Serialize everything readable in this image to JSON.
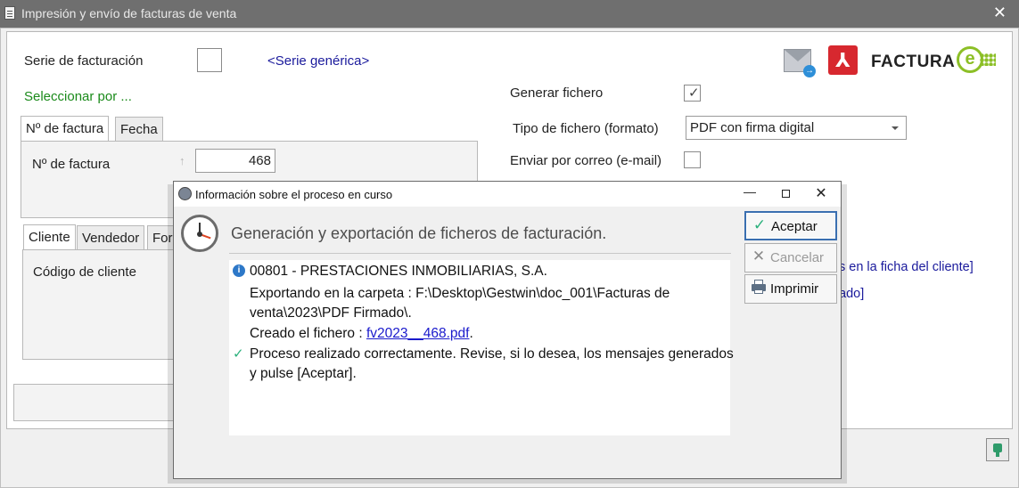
{
  "main_window": {
    "title": "Impresión y envío de facturas de venta",
    "close_symbol": "✕"
  },
  "form": {
    "serie_label": "Serie de facturación",
    "serie_link": "<Serie genérica>",
    "seleccionar_label": "Seleccionar por ...",
    "tabs_top": [
      "Nº de factura",
      "Fecha"
    ],
    "nfactura_label": "Nº de factura",
    "nfactura_value": "468",
    "tabs_bottom": [
      "Cliente",
      "Vendedor",
      "For"
    ],
    "codigo_cliente_label": "Código de cliente",
    "generar_fichero_label": "Generar fichero",
    "generar_fichero_checked": true,
    "tipo_fichero_label": "Tipo de fichero (formato)",
    "tipo_fichero_value": "PDF con firma digital",
    "enviar_correo_label": "Enviar por correo (e-mail)",
    "enviar_correo_checked": false,
    "right_link_1": "s en la ficha del cliente]",
    "right_link_2": "ado]",
    "logo_facturae_text": "FACTURA",
    "logo_facturae_letter": "e",
    "pdf_logo_glyph": "⅄"
  },
  "dialog": {
    "title": "Información sobre el proceso en curso",
    "heading": "Generación y exportación de ficheros de facturación.",
    "messages": {
      "company": "00801 - PRESTACIONES INMOBILIARIAS, S.A.",
      "exporting_1": "Exportando en la carpeta : F:\\Desktop\\Gestwin\\doc_001\\Facturas de",
      "exporting_2": "venta\\2023\\PDF Firmado\\.",
      "created_prefix": "Creado el fichero : ",
      "created_file": "fv2023__468.pdf",
      "created_suffix": ".",
      "done_1": "Proceso realizado correctamente. Revise, si lo desea, los mensajes generados",
      "done_2": "y pulse [Aceptar]."
    },
    "buttons": {
      "accept": "Aceptar",
      "cancel": "Cancelar",
      "print": "Imprimir"
    },
    "window_buttons": {
      "minimize": "—",
      "close": "✕"
    }
  },
  "colors": {
    "accent_green": "#1a8a1a",
    "link_blue": "#1a1a9c",
    "ok_teal": "#2bb17c",
    "pdf_red": "#d7282f",
    "facturae_green": "#8cbf26"
  }
}
